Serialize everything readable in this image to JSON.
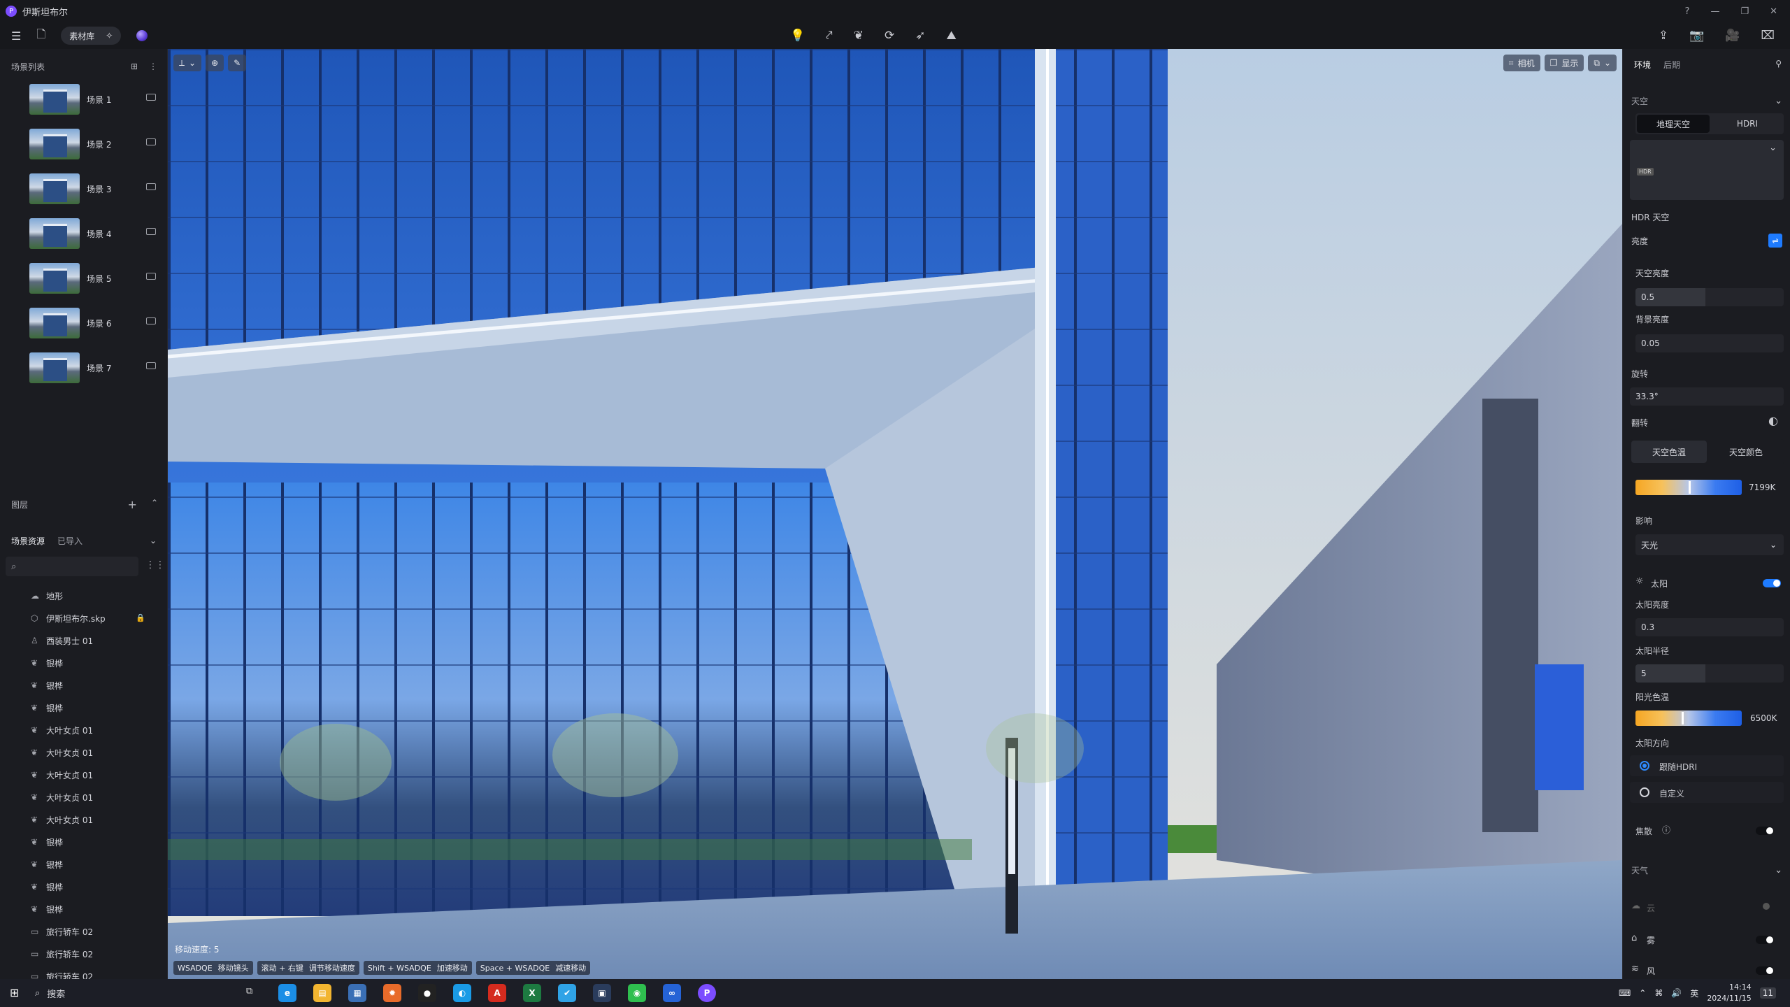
{
  "window": {
    "title": "伊斯坦布尔"
  },
  "toolbar": {
    "library": "素材库"
  },
  "left": {
    "scene_list_title": "场景列表",
    "scenes": [
      "场景 1",
      "场景 2",
      "场景 3",
      "场景 4",
      "场景 5",
      "场景 6",
      "场景 7"
    ],
    "layers_title": "图层",
    "tab_assets": "场景资源",
    "tab_imported": "已导入",
    "search_placeholder": "",
    "tree": [
      {
        "label": "地形",
        "icon": "terrain-icon"
      },
      {
        "label": "伊斯坦布尔.skp",
        "icon": "model-icon",
        "locked": true
      },
      {
        "label": "西装男士 01",
        "icon": "person-icon"
      },
      {
        "label": "银桦",
        "icon": "tree-icon"
      },
      {
        "label": "银桦",
        "icon": "tree-icon"
      },
      {
        "label": "银桦",
        "icon": "tree-icon"
      },
      {
        "label": "大叶女贞 01",
        "icon": "tree-icon"
      },
      {
        "label": "大叶女贞 01",
        "icon": "tree-icon"
      },
      {
        "label": "大叶女贞 01",
        "icon": "tree-icon"
      },
      {
        "label": "大叶女贞 01",
        "icon": "tree-icon"
      },
      {
        "label": "大叶女贞 01",
        "icon": "tree-icon"
      },
      {
        "label": "银桦",
        "icon": "tree-icon"
      },
      {
        "label": "银桦",
        "icon": "tree-icon"
      },
      {
        "label": "银桦",
        "icon": "tree-icon"
      },
      {
        "label": "银桦",
        "icon": "tree-icon"
      },
      {
        "label": "旅行轿车 02",
        "icon": "car-icon"
      },
      {
        "label": "旅行轿车 02",
        "icon": "car-icon"
      },
      {
        "label": "旅行轿车 02",
        "icon": "car-icon"
      }
    ]
  },
  "viewport": {
    "camera_btn": "相机",
    "display_btn": "显示",
    "move_speed": "移动速度: 5",
    "hints": [
      {
        "key": "WSADQE",
        "desc": "移动镜头"
      },
      {
        "key": "滚动 + 右键",
        "desc": "调节移动速度"
      },
      {
        "key": "Shift + WSADQE",
        "desc": "加速移动"
      },
      {
        "key": "Space + WSADQE",
        "desc": "减速移动"
      }
    ]
  },
  "right": {
    "tab_env": "环境",
    "tab_post": "后期",
    "sky_title": "天空",
    "seg_geo": "地理天空",
    "seg_hdri": "HDRI",
    "hdr_badge": "HDR",
    "hdr_sky": "HDR 天空",
    "brightness": "亮度",
    "sky_brightness": "天空亮度",
    "sky_brightness_val": "0.5",
    "bg_brightness": "背景亮度",
    "bg_brightness_val": "0.05",
    "rotation": "旋转",
    "rotation_val": "33.3°",
    "flip": "翻转",
    "seg_temp": "天空色温",
    "seg_color": "天空颜色",
    "sky_temp_val": "7199K",
    "influence": "影响",
    "influence_val": "天光",
    "sun": "太阳",
    "sun_brightness": "太阳亮度",
    "sun_brightness_val": "0.3",
    "sun_radius": "太阳半径",
    "sun_radius_val": "5",
    "sun_temp": "阳光色温",
    "sun_temp_val": "6500K",
    "sun_dir": "太阳方向",
    "follow_hdri": "跟随HDRI",
    "custom": "自定义",
    "scatter": "焦散",
    "weather": "天气",
    "cloud": "云",
    "fog": "雾",
    "wind": "风"
  },
  "taskbar": {
    "search": "搜索",
    "ime": "英",
    "time": "14:14",
    "date": "2024/11/15",
    "notif": "11"
  }
}
